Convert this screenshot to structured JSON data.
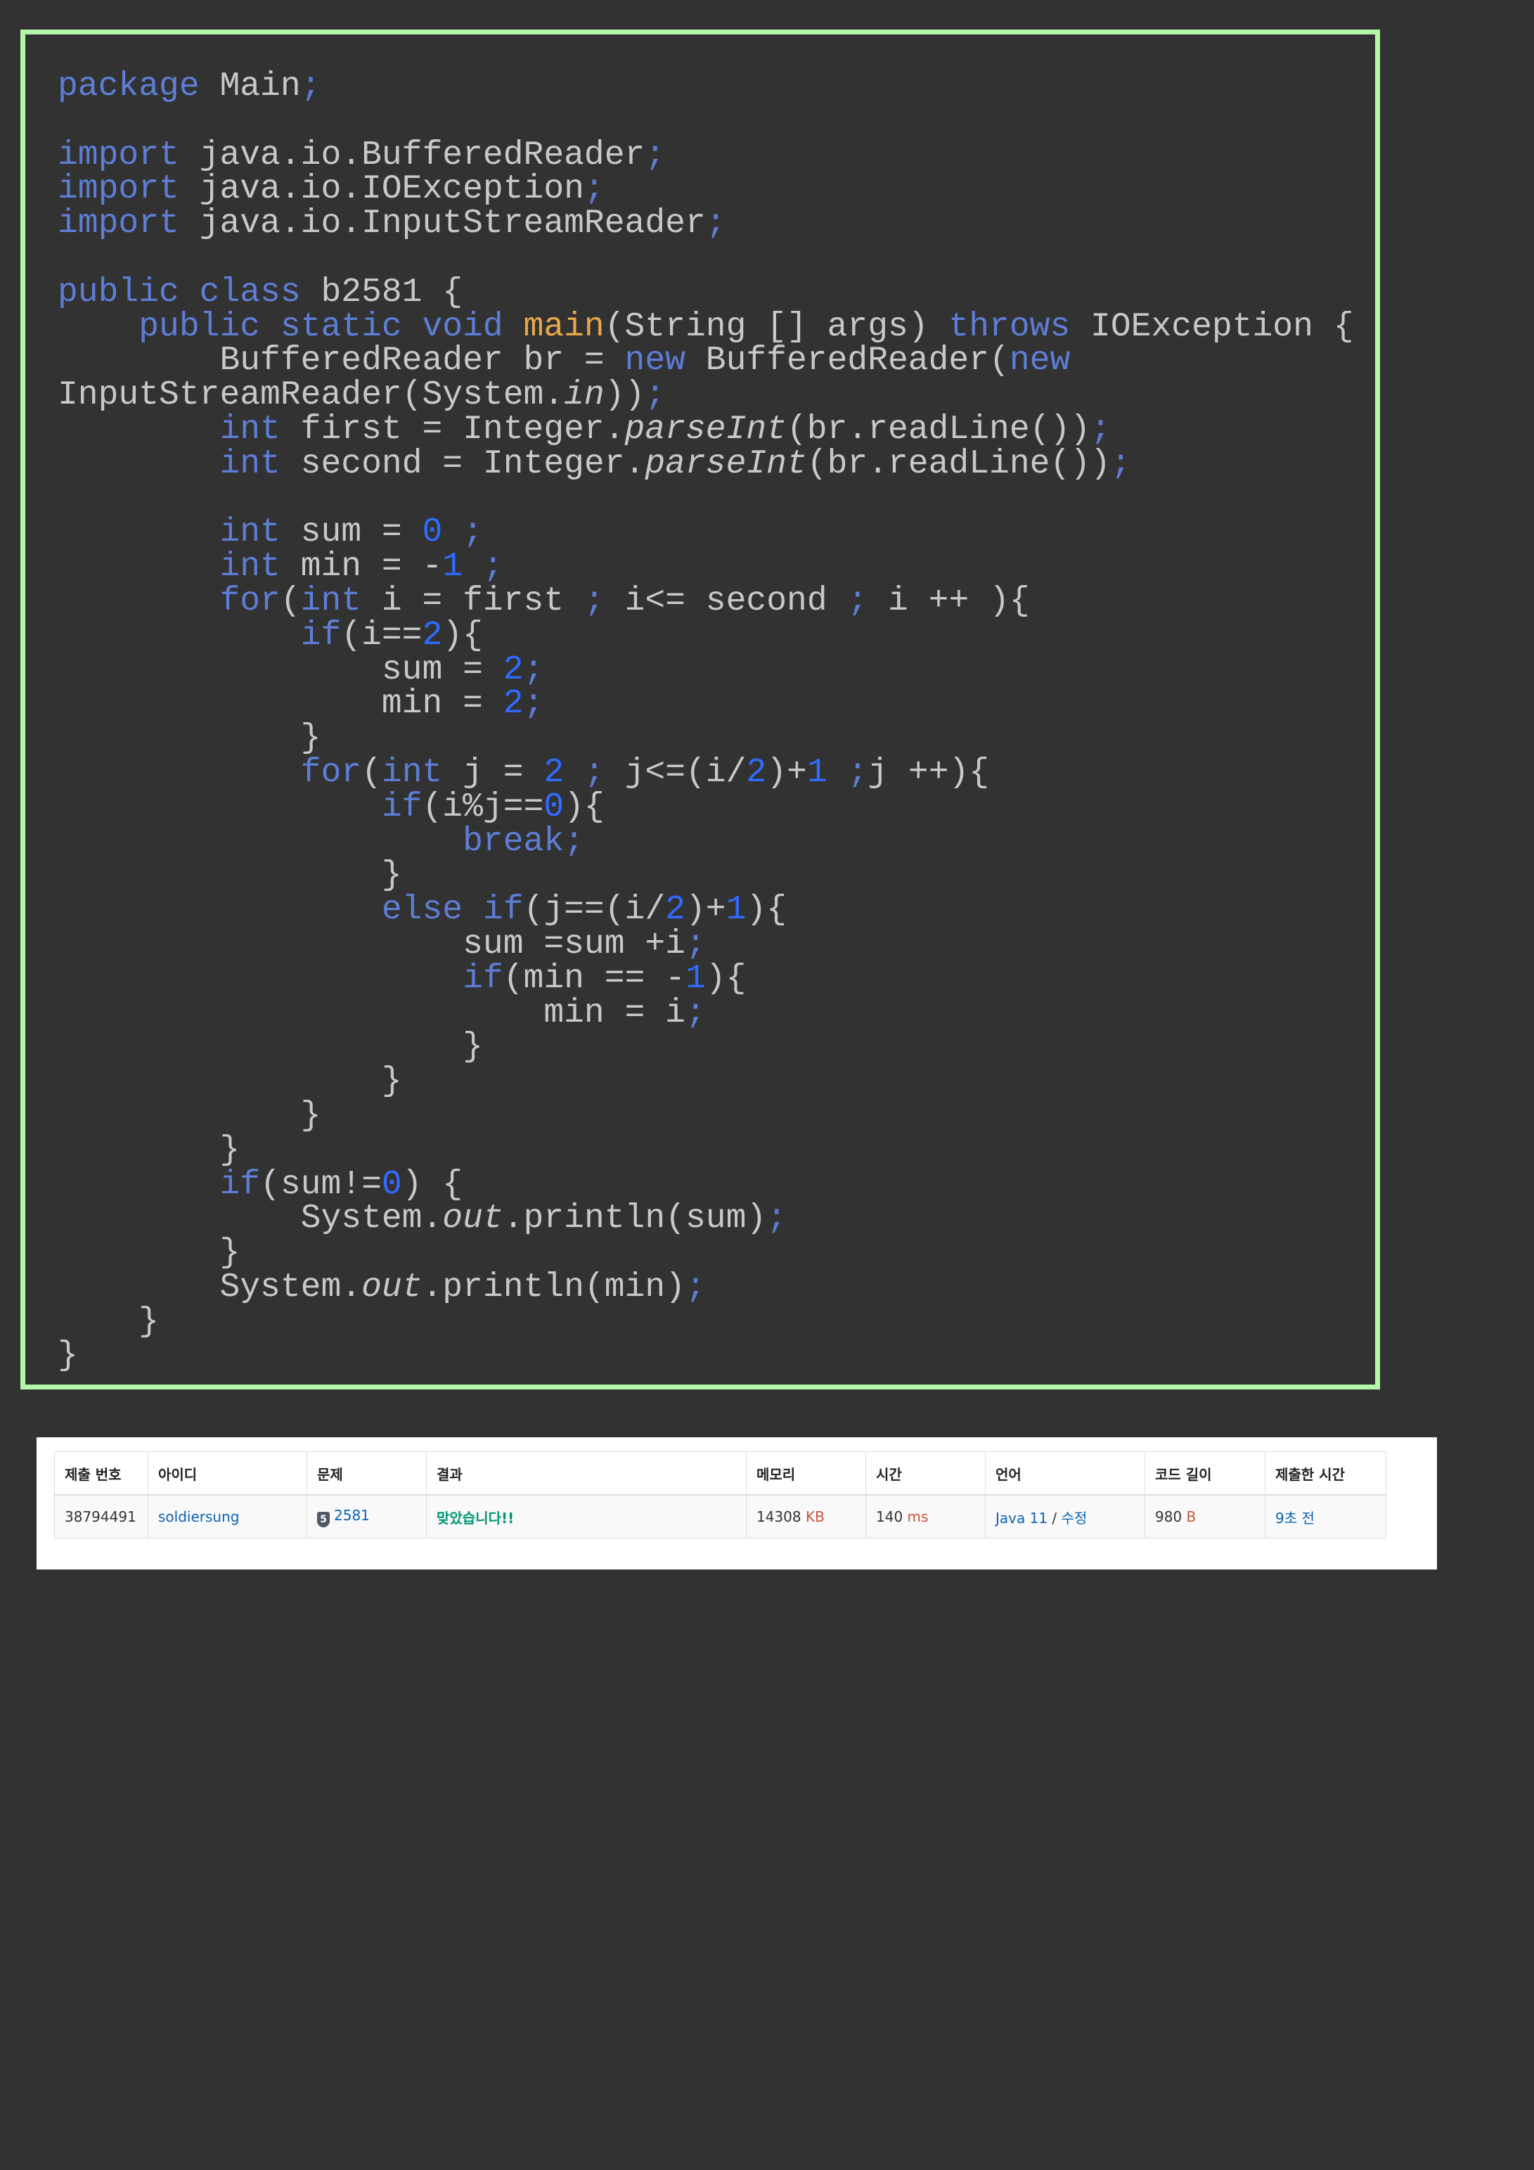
{
  "code": {
    "lines": [
      [
        [
          "kw",
          "package"
        ],
        [
          "txt",
          " Main"
        ],
        [
          "punc",
          ";"
        ]
      ],
      [],
      [
        [
          "kw",
          "import"
        ],
        [
          "txt",
          " java.io.BufferedReader"
        ],
        [
          "punc",
          ";"
        ]
      ],
      [
        [
          "kw",
          "import"
        ],
        [
          "txt",
          " java.io.IOException"
        ],
        [
          "punc",
          ";"
        ]
      ],
      [
        [
          "kw",
          "import"
        ],
        [
          "txt",
          " java.io.InputStreamReader"
        ],
        [
          "punc",
          ";"
        ]
      ],
      [],
      [
        [
          "kw",
          "public class"
        ],
        [
          "txt",
          " b2581 {"
        ]
      ],
      [
        [
          "txt",
          "    "
        ],
        [
          "kw",
          "public static void"
        ],
        [
          "txt",
          " "
        ],
        [
          "fn",
          "main"
        ],
        [
          "txt",
          "(String [] args) "
        ],
        [
          "kw",
          "throws"
        ],
        [
          "txt",
          " IOException {"
        ]
      ],
      [
        [
          "txt",
          "        BufferedReader br = "
        ],
        [
          "kw",
          "new"
        ],
        [
          "txt",
          " BufferedReader("
        ],
        [
          "kw",
          "new"
        ]
      ],
      [
        [
          "txt",
          "InputStreamReader(System."
        ],
        [
          "it",
          "in"
        ],
        [
          "txt",
          "))"
        ],
        [
          "punc",
          ";"
        ]
      ],
      [
        [
          "txt",
          "        "
        ],
        [
          "kw",
          "int"
        ],
        [
          "txt",
          " first = Integer."
        ],
        [
          "it",
          "parseInt"
        ],
        [
          "txt",
          "(br.readLine())"
        ],
        [
          "punc",
          ";"
        ]
      ],
      [
        [
          "txt",
          "        "
        ],
        [
          "kw",
          "int"
        ],
        [
          "txt",
          " second = Integer."
        ],
        [
          "it",
          "parseInt"
        ],
        [
          "txt",
          "(br.readLine())"
        ],
        [
          "punc",
          ";"
        ]
      ],
      [],
      [
        [
          "txt",
          "        "
        ],
        [
          "kw",
          "int"
        ],
        [
          "txt",
          " sum = "
        ],
        [
          "num",
          "0"
        ],
        [
          "txt",
          " "
        ],
        [
          "punc",
          ";"
        ]
      ],
      [
        [
          "txt",
          "        "
        ],
        [
          "kw",
          "int"
        ],
        [
          "txt",
          " min = -"
        ],
        [
          "num",
          "1"
        ],
        [
          "txt",
          " "
        ],
        [
          "punc",
          ";"
        ]
      ],
      [
        [
          "txt",
          "        "
        ],
        [
          "kw",
          "for"
        ],
        [
          "txt",
          "("
        ],
        [
          "kw",
          "int"
        ],
        [
          "txt",
          " i = first "
        ],
        [
          "punc",
          ";"
        ],
        [
          "txt",
          " i<= second "
        ],
        [
          "punc",
          ";"
        ],
        [
          "txt",
          " i ++ ){"
        ]
      ],
      [
        [
          "txt",
          "            "
        ],
        [
          "kw",
          "if"
        ],
        [
          "txt",
          "(i=="
        ],
        [
          "num",
          "2"
        ],
        [
          "txt",
          "){"
        ]
      ],
      [
        [
          "txt",
          "                sum = "
        ],
        [
          "num",
          "2"
        ],
        [
          "punc",
          ";"
        ]
      ],
      [
        [
          "txt",
          "                min = "
        ],
        [
          "num",
          "2"
        ],
        [
          "punc",
          ";"
        ]
      ],
      [
        [
          "txt",
          "            }"
        ]
      ],
      [
        [
          "txt",
          "            "
        ],
        [
          "kw",
          "for"
        ],
        [
          "txt",
          "("
        ],
        [
          "kw",
          "int"
        ],
        [
          "txt",
          " j = "
        ],
        [
          "num",
          "2"
        ],
        [
          "txt",
          " "
        ],
        [
          "punc",
          ";"
        ],
        [
          "txt",
          " j<=(i/"
        ],
        [
          "num",
          "2"
        ],
        [
          "txt",
          ")+"
        ],
        [
          "num",
          "1"
        ],
        [
          "txt",
          " "
        ],
        [
          "punc",
          ";"
        ],
        [
          "txt",
          "j ++){"
        ]
      ],
      [
        [
          "txt",
          "                "
        ],
        [
          "kw",
          "if"
        ],
        [
          "txt",
          "(i%j=="
        ],
        [
          "num",
          "0"
        ],
        [
          "txt",
          "){"
        ]
      ],
      [
        [
          "txt",
          "                    "
        ],
        [
          "kw",
          "break"
        ],
        [
          "punc",
          ";"
        ]
      ],
      [
        [
          "txt",
          "                }"
        ]
      ],
      [
        [
          "txt",
          "                "
        ],
        [
          "kw",
          "else if"
        ],
        [
          "txt",
          "(j==(i/"
        ],
        [
          "num",
          "2"
        ],
        [
          "txt",
          ")+"
        ],
        [
          "num",
          "1"
        ],
        [
          "txt",
          "){"
        ]
      ],
      [
        [
          "txt",
          "                    sum =sum +i"
        ],
        [
          "punc",
          ";"
        ]
      ],
      [
        [
          "txt",
          "                    "
        ],
        [
          "kw",
          "if"
        ],
        [
          "txt",
          "(min == -"
        ],
        [
          "num",
          "1"
        ],
        [
          "txt",
          "){"
        ]
      ],
      [
        [
          "txt",
          "                        min = i"
        ],
        [
          "punc",
          ";"
        ]
      ],
      [
        [
          "txt",
          "                    }"
        ]
      ],
      [
        [
          "txt",
          "                }"
        ]
      ],
      [
        [
          "txt",
          "            }"
        ]
      ],
      [
        [
          "txt",
          "        }"
        ]
      ],
      [
        [
          "txt",
          "        "
        ],
        [
          "kw",
          "if"
        ],
        [
          "txt",
          "(sum!="
        ],
        [
          "num",
          "0"
        ],
        [
          "txt",
          ") {"
        ]
      ],
      [
        [
          "txt",
          "            System."
        ],
        [
          "it",
          "out"
        ],
        [
          "txt",
          ".println(sum)"
        ],
        [
          "punc",
          ";"
        ]
      ],
      [
        [
          "txt",
          "        }"
        ]
      ],
      [
        [
          "txt",
          "        System."
        ],
        [
          "it",
          "out"
        ],
        [
          "txt",
          ".println(min)"
        ],
        [
          "punc",
          ";"
        ]
      ],
      [
        [
          "txt",
          "    }"
        ]
      ],
      [
        [
          "txt",
          "}"
        ]
      ]
    ]
  },
  "submission": {
    "headers": {
      "id": "제출 번호",
      "user": "아이디",
      "problem": "문제",
      "result": "결과",
      "memory": "메모리",
      "time": "시간",
      "language": "언어",
      "code_length": "코드 길이",
      "submitted": "제출한 시간"
    },
    "row": {
      "id": "38794491",
      "user": "soldiersung",
      "problem_tier": "5",
      "problem": "2581",
      "result": "맞았습니다!!",
      "memory": "14308",
      "memory_unit": "KB",
      "time": "140",
      "time_unit": "ms",
      "language": "Java 11",
      "language_sep": "/",
      "edit": "수정",
      "code_length": "980",
      "code_length_unit": "B",
      "submitted": "9초 전"
    }
  }
}
